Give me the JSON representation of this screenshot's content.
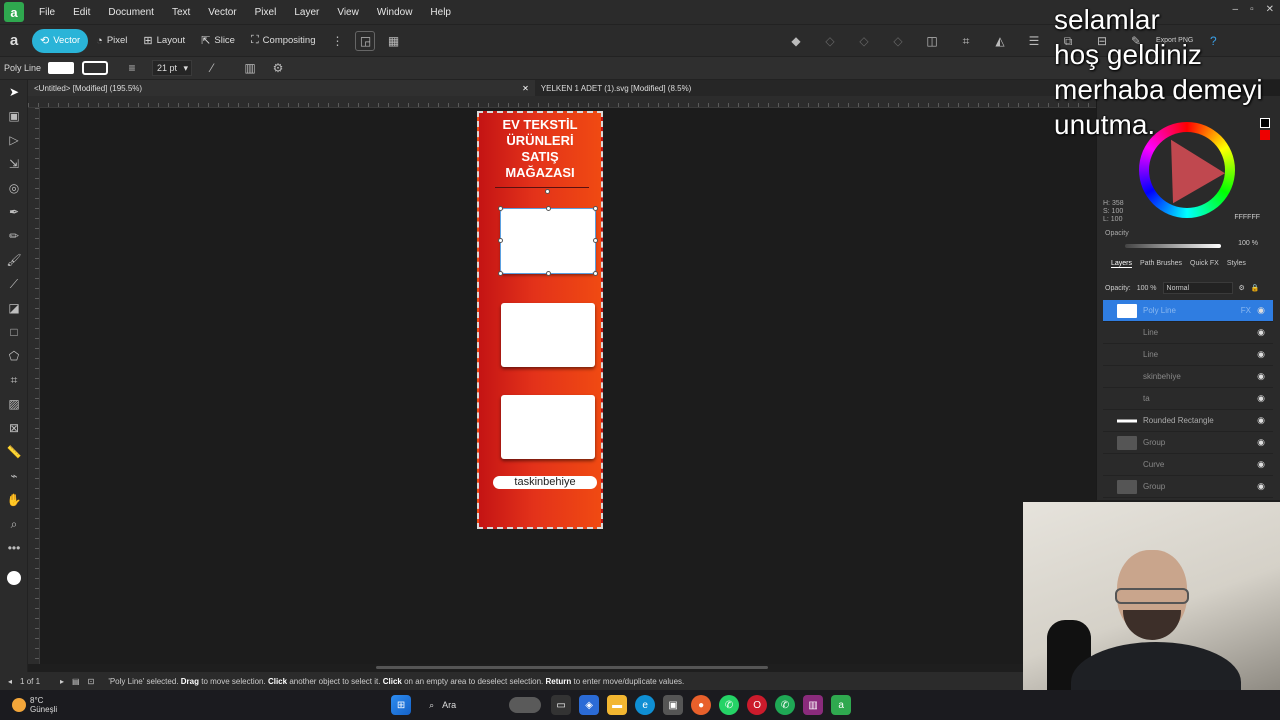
{
  "menubar": {
    "items": [
      "File",
      "Edit",
      "Document",
      "Text",
      "Vector",
      "Pixel",
      "Layer",
      "View",
      "Window",
      "Help"
    ]
  },
  "toolbar": {
    "personas": [
      "Vector",
      "Pixel",
      "Layout",
      "Slice",
      "Compositing"
    ],
    "export": "Export PNG"
  },
  "contextbar": {
    "tool_label": "Poly Line",
    "stroke_width": "21 pt"
  },
  "tabs": [
    "<Untitled> [Modified] (195.5%)",
    "YELKEN 1 ADET (1).svg [Modified] (8.5%)"
  ],
  "artboard": {
    "title_lines": [
      "EV TEKSTİL",
      "ÜRÜNLERİ",
      "SATIŞ",
      "MAĞAZASI"
    ],
    "name_label": "taskinbehiye",
    "colors": {
      "red": "#c41414",
      "orange": "#f04a12"
    }
  },
  "color_panel": {
    "h": "H: 358",
    "s": "S: 100",
    "l": "L: 100",
    "hex": "FFFFFF",
    "opacity_label": "Opacity",
    "opacity_value": "100 %"
  },
  "layers_panel": {
    "tabs": [
      "Layers",
      "Path Brushes",
      "Quick FX",
      "Styles"
    ],
    "opacity_label": "Opacity:",
    "opacity_value": "100 %",
    "blend_mode": "Normal",
    "layers": [
      {
        "name": "Poly Line",
        "selected": true
      },
      {
        "name": "Line",
        "selected": false
      },
      {
        "name": "Line",
        "selected": false
      },
      {
        "name": "skinbehiye",
        "selected": false
      },
      {
        "name": "ta",
        "selected": false
      },
      {
        "name": "Rounded Rectangle",
        "selected": false
      },
      {
        "name": "Group",
        "selected": false
      },
      {
        "name": "Curve",
        "selected": false
      },
      {
        "name": "Group",
        "selected": false
      }
    ]
  },
  "overlay": {
    "lines": [
      "selamlar",
      "hoş geldiniz",
      "merhaba demeyi",
      "unutma."
    ]
  },
  "statusbar": {
    "page": "1 of 1",
    "msg_1": "'Poly Line' selected.",
    "msg_drag": "Drag",
    "msg_2": "to move selection.",
    "msg_click": "Click",
    "msg_3": "another object to select it.",
    "msg_click2": "Click",
    "msg_4": "on an empty area to deselect selection.",
    "msg_return": "Return",
    "msg_5": "to enter move/duplicate values."
  },
  "taskbar": {
    "temp": "8°C",
    "location": "Güneşli",
    "search": "Ara"
  }
}
